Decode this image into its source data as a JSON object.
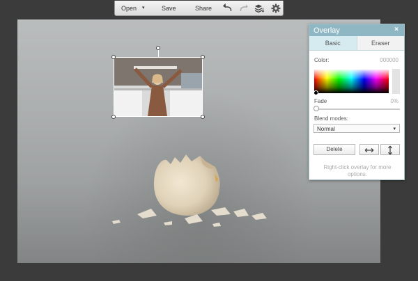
{
  "toolbar": {
    "open_label": "Open",
    "save_label": "Save",
    "share_label": "Share",
    "open_caret": "▾",
    "icons": [
      "undo-icon",
      "redo-icon",
      "layers-icon",
      "gear-icon"
    ]
  },
  "panel": {
    "title": "Overlay",
    "close": "×",
    "tabs": [
      {
        "label": "Basic",
        "active": true
      },
      {
        "label": "Eraser",
        "active": false
      }
    ],
    "color_label": "Color:",
    "color_value": "000000",
    "fade_label": "Fade",
    "fade_value": "0%",
    "fade_fraction": 0,
    "blend_label": "Blend modes:",
    "blend_value": "Normal",
    "blend_caret": "▾",
    "delete_label": "Delete",
    "hint": "Right-click overlay for more options."
  },
  "colors": {
    "panel_header": "#8fb7c3",
    "toolbar_bg": "#e8e8e8",
    "workspace_bg": "#3b3b3b"
  }
}
